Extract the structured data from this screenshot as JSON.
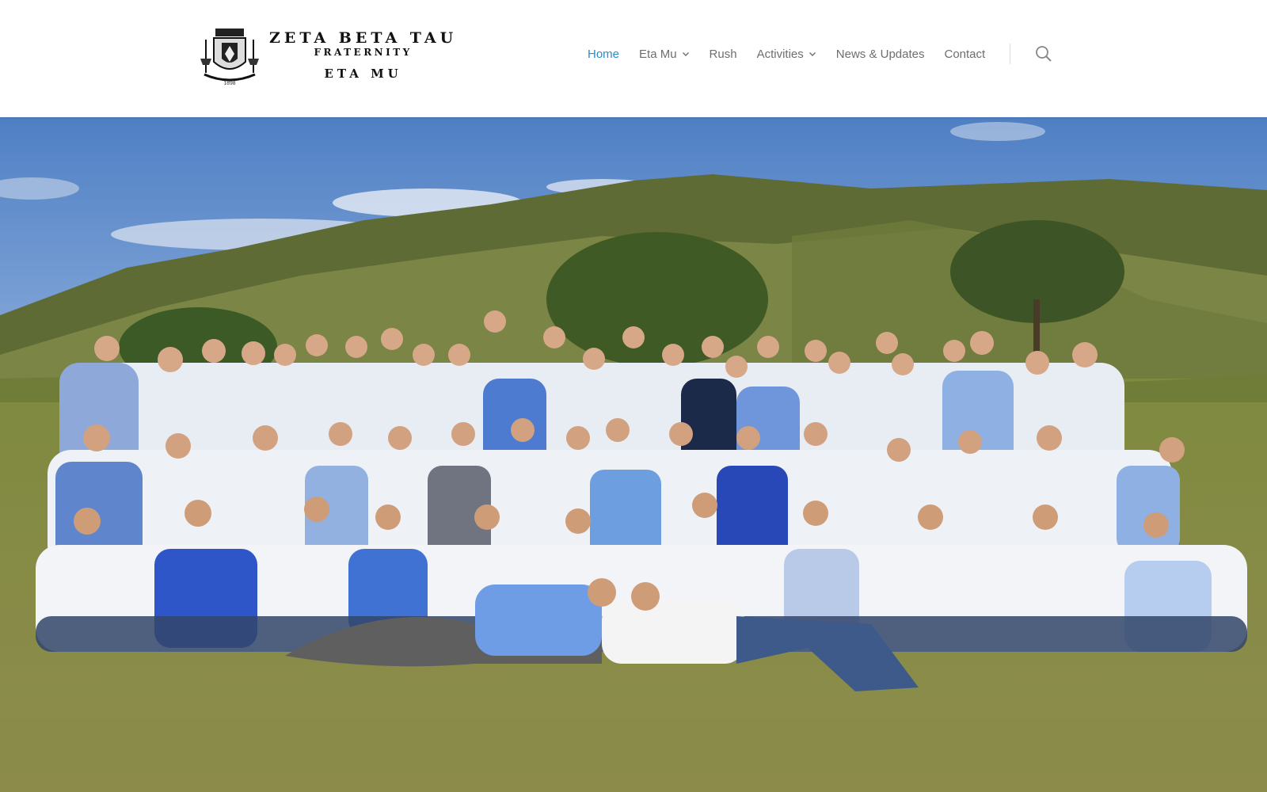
{
  "site": {
    "logo": {
      "line1": "ZETA BETA TAU",
      "line2": "FRATERNITY",
      "line3": "ETA MU",
      "crest_text": "1898"
    }
  },
  "nav": {
    "items": [
      {
        "label": "Home",
        "active": true
      },
      {
        "label": "Eta Mu",
        "dropdown": true
      },
      {
        "label": "Rush"
      },
      {
        "label": "Activities",
        "dropdown": true
      },
      {
        "label": "News & Updates"
      },
      {
        "label": "Contact"
      }
    ],
    "search_icon": "search-icon"
  },
  "hero": {
    "image": "group-photo",
    "colors": {
      "sky": "#5a86c6",
      "hills": "#6f7a42",
      "grass": "#8a8c44",
      "accent": "#2a8cc4"
    }
  }
}
